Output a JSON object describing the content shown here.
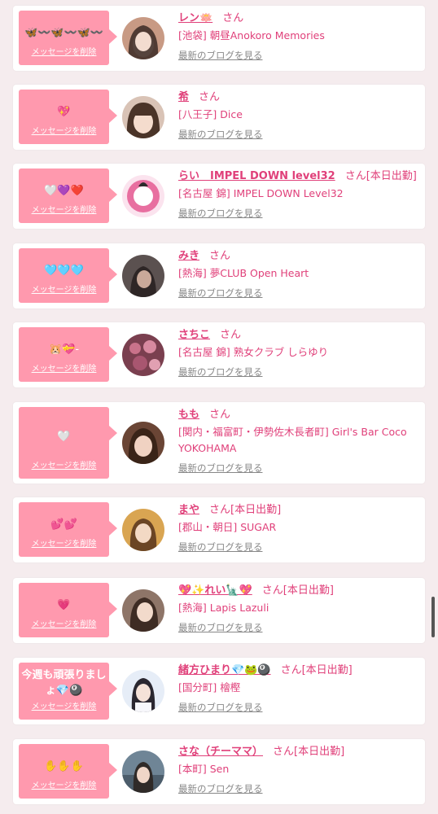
{
  "items": [
    {
      "message": "🦋〰️🦋〰️🦋〰️",
      "delete_label": "メッセージを削除",
      "name": "レン🪷",
      "san": "さん",
      "badge": "",
      "shop": "[池袋] 朝昼Anokoro Memories",
      "blog_link": "最新のブログを見る",
      "avatar_color": "#c89a84"
    },
    {
      "message": "💖",
      "delete_label": "メッセージを削除",
      "name": "希",
      "san": "さん",
      "badge": "",
      "shop": "[八王子] Dice",
      "blog_link": "最新のブログを見る",
      "avatar_color": "#8a6a5a"
    },
    {
      "message": "🤍💜❤️",
      "delete_label": "メッセージを削除",
      "name": "らい　IMPEL DOWN level32",
      "san": "さん",
      "badge": "[本日出勤]",
      "shop": "[名古屋 錦] IMPEL DOWN Level32",
      "blog_link": "最新のブログを見る",
      "avatar_color": "#e86fa0"
    },
    {
      "message": "🩵🩵🩵",
      "delete_label": "メッセージを削除",
      "name": "みき",
      "san": "さん",
      "badge": "",
      "shop": "[熱海] 夢CLUB Open Heart",
      "blog_link": "最新のブログを見る",
      "avatar_color": "#5b5150"
    },
    {
      "message": "🐹💝-",
      "delete_label": "メッセージを削除",
      "name": "さちこ",
      "san": "さん",
      "badge": "",
      "shop": "[名古屋 錦] 熟女クラブ しらゆり",
      "blog_link": "最新のブログを見る",
      "avatar_color": "#7a3f4f"
    },
    {
      "message": "🤍",
      "delete_label": "メッセージを削除",
      "name": "もも",
      "san": "さん",
      "badge": "",
      "shop": "[関内・福富町・伊勢佐木長者町] Girl's Bar Coco YOKOHAMA",
      "blog_link": "最新のブログを見る",
      "avatar_color": "#6a4535"
    },
    {
      "message": "💕💕",
      "delete_label": "メッセージを削除",
      "name": "まや",
      "san": "さん",
      "badge": "[本日出勤]",
      "shop": "[郡山・朝日] SUGAR",
      "blog_link": "最新のブログを見る",
      "avatar_color": "#d9a552"
    },
    {
      "message": "💗",
      "delete_label": "メッセージを削除",
      "name": "💖✨れい🗽💖",
      "san": "さん",
      "badge": "[本日出勤]",
      "shop": "[熱海] Lapis Lazuli",
      "blog_link": "最新のブログを見る",
      "avatar_color": "#8e7568"
    },
    {
      "message": "今週も頑張りまし\nょ💎🎱",
      "delete_label": "メッセージを削除",
      "name": "緒方ひまり💎🐸🎱",
      "san": "さん",
      "badge": "[本日出勤]",
      "shop": "[国分町] 檜樫",
      "blog_link": "最新のブログを見る",
      "avatar_color": "#c7d4e8"
    },
    {
      "message": "✋✋✋",
      "delete_label": "メッセージを削除",
      "name": "さな（チーママ）",
      "san": "さん",
      "badge": "[本日出勤]",
      "shop": "[本町] Sen",
      "blog_link": "最新のブログを見る",
      "avatar_color": "#6f8596"
    }
  ]
}
